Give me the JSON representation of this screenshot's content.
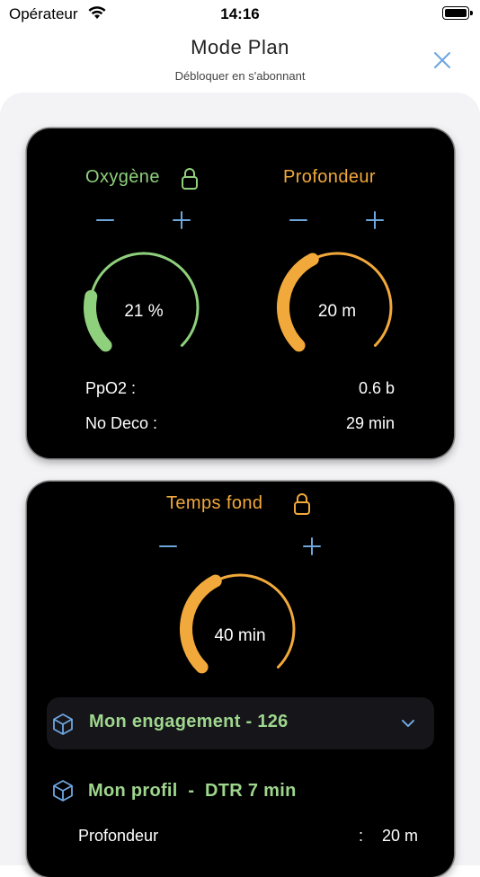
{
  "status_bar": {
    "carrier": "Opérateur",
    "time": "14:16"
  },
  "nav": {
    "title": "Mode Plan",
    "subtitle": "Débloquer en s'abonnant",
    "close_icon": "close-icon"
  },
  "colors": {
    "green": "#8fd07c",
    "orange": "#f2a93b",
    "accent_blue": "#6ea6de",
    "card_bg": "#000000"
  },
  "gas_card": {
    "oxygen": {
      "title": "Oxygène",
      "value_text": "21 %",
      "level": 0.21,
      "locked": true,
      "minus": "−",
      "plus": "+"
    },
    "depth": {
      "title": "Profondeur",
      "value_text": "20 m",
      "level": 0.4,
      "minus": "−",
      "plus": "+"
    },
    "ppo2": {
      "label": "PpO2 :",
      "value": "0.6 b"
    },
    "no_deco": {
      "label": "No Deco :",
      "value": "29 min"
    }
  },
  "time_card": {
    "bottom_time": {
      "title": "Temps fond",
      "value_text": "40 min",
      "level": 0.4,
      "locked": true,
      "minus": "−",
      "plus": "+"
    },
    "engagement": {
      "title": "Mon engagement - 126",
      "expanded": false
    },
    "profile": {
      "title": "Mon profil  -  DTR 7 min"
    },
    "profile_rows": [
      {
        "label": "Profondeur",
        "sep": ":",
        "value": "20 m"
      }
    ]
  }
}
